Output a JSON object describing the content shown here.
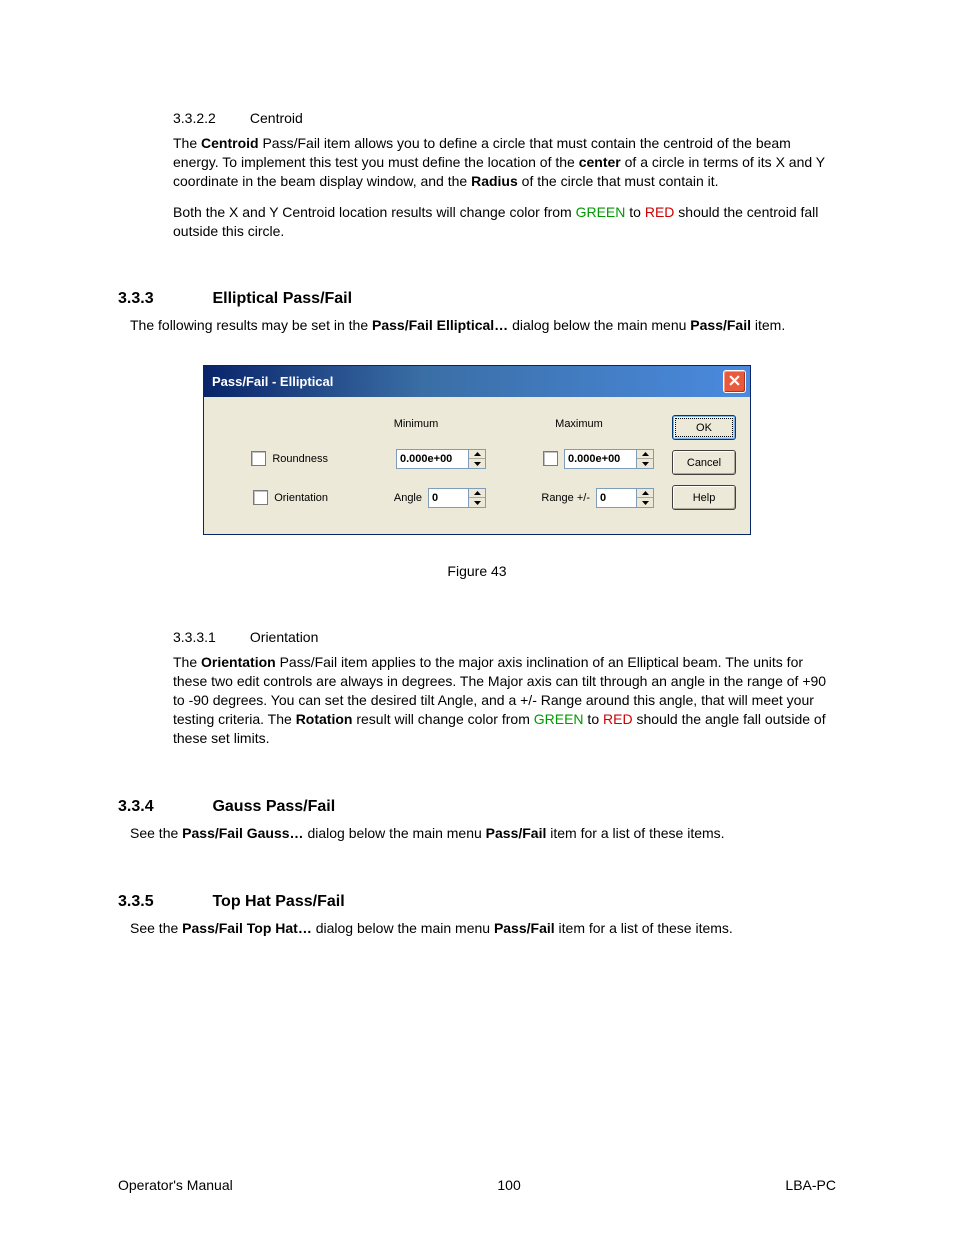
{
  "sections": {
    "centroid": {
      "num": "3.3.2.2",
      "title": "Centroid",
      "p1a": "The ",
      "p1b": "Centroid",
      "p1c": " Pass/Fail item allows you to define a circle that must contain the centroid of the beam energy.  To implement this test you must define the location of the ",
      "p1d": "center",
      "p1e": " of a circle in terms of its X and Y coordinate in the beam display window, and the ",
      "p1f": "Radius",
      "p1g": " of the circle that must contain it.",
      "p2a": "Both the X and Y Centroid location results will change color from ",
      "p2b": "GREEN",
      "p2c": " to ",
      "p2d": "RED",
      "p2e": " should the centroid fall outside this circle."
    },
    "elliptical": {
      "num": "3.3.3",
      "title": "Elliptical Pass/Fail",
      "p1a": "The following results may be set in the ",
      "p1b": "Pass/Fail Elliptical…",
      "p1c": " dialog below the main menu ",
      "p1d": "Pass/Fail",
      "p1e": " item."
    },
    "orientation": {
      "num": "3.3.3.1",
      "title": "Orientation",
      "p1a": "The ",
      "p1b": "Orientation",
      "p1c": " Pass/Fail item applies to the major axis inclination of an Elliptical beam.  The units for these two edit controls are always in degrees.  The Major axis can tilt through an angle in the range of +90 to -90 degrees.  You can set the desired tilt Angle, and a +/- Range around this angle, that will meet your testing criteria.  The ",
      "p1d": "Rotation",
      "p1e": " result will change color from ",
      "p1f": "GREEN",
      "p1g": " to ",
      "p1h": "RED",
      "p1i": " should the angle fall outside of these set limits."
    },
    "gauss": {
      "num": "3.3.4",
      "title": "Gauss Pass/Fail",
      "p1a": "See the ",
      "p1b": "Pass/Fail Gauss…",
      "p1c": " dialog below the main menu ",
      "p1d": "Pass/Fail",
      "p1e": " item for a list of these items."
    },
    "tophat": {
      "num": "3.3.5",
      "title": "Top Hat Pass/Fail",
      "p1a": "See the ",
      "p1b": "Pass/Fail Top Hat…",
      "p1c": " dialog below the main menu ",
      "p1d": "Pass/Fail",
      "p1e": " item for a list of these items."
    }
  },
  "dialog": {
    "title": "Pass/Fail - Elliptical",
    "headers": {
      "min": "Minimum",
      "max": "Maximum"
    },
    "rows": {
      "roundness": {
        "label": "Roundness",
        "min_value": "0.000e+00",
        "max_value": "0.000e+00"
      },
      "orientation": {
        "label": "Orientation",
        "angle_label": "Angle",
        "angle_value": "0",
        "range_label": "Range +/-",
        "range_value": "0"
      }
    },
    "buttons": {
      "ok": "OK",
      "cancel": "Cancel",
      "help": "Help"
    }
  },
  "figure_caption": "Figure 43",
  "footer": {
    "left": "Operator's Manual",
    "center": "100",
    "right": "LBA-PC"
  }
}
